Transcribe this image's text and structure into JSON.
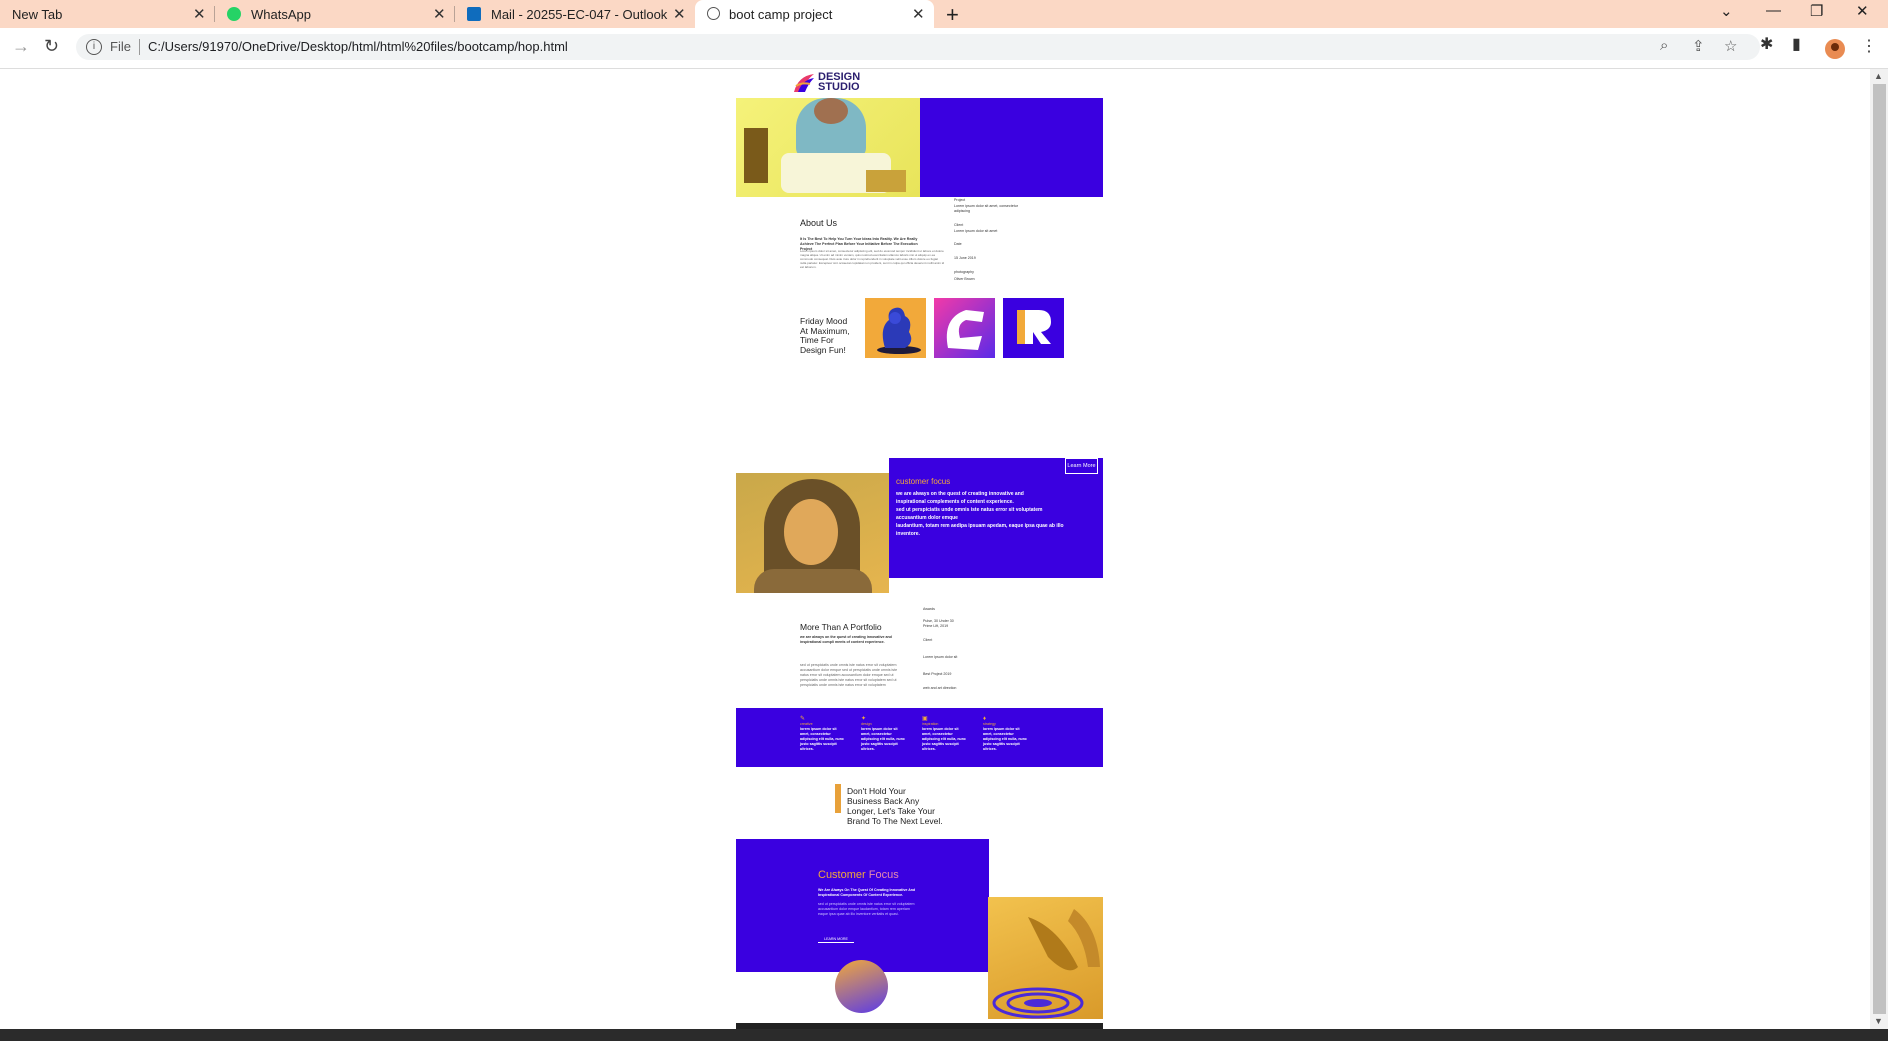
{
  "browser": {
    "tabs": [
      {
        "title": "New Tab",
        "active": false
      },
      {
        "title": "WhatsApp",
        "active": false
      },
      {
        "title": "Mail - 20255-EC-047 - Outlook",
        "active": false
      },
      {
        "title": "boot camp project",
        "active": true
      }
    ],
    "address": {
      "scheme_label": "File",
      "url": "C:/Users/91970/OneDrive/Desktop/html/html%20files/bootcamp/hop.html"
    },
    "colors": {
      "tabbar": "#fbd8c5",
      "omnibox": "#f1f3f4"
    }
  },
  "site": {
    "logo": {
      "line1": "DESIGN",
      "line2": "STUDIO"
    },
    "hero_meta": [
      {
        "label": "Project",
        "value": "Lorem ipsum dolor sit amet, consectetur adipiscing"
      },
      {
        "label": "Client",
        "value": "Lorem ipsum dolor sit amet"
      },
      {
        "label": "Date",
        "value": "15 June 2019"
      },
      {
        "label": "photography",
        "value": "Oliver Brown"
      }
    ],
    "about": {
      "title": "About Us",
      "lead": "It Is The Best To Help You Turn Your Ideas Into Reality. We Are Really Achieve The Perfect Plan Before Your Initiative Before The Execution Project",
      "body": "Lorem ipsum dolor sit amet, consectetur adipiscing elit, sed do eiusmod tempor incididunt ut labore et dolore magna aliqua. Ut enim ad minim veniam, quis nostrud exercitation ullamco laboris nisi ut aliquip ex ea commodo consequat. Duis aute irure dolor in reprehenderit in voluptate velit esse cillum dolore eu fugiat nulla pariatur. Excepteur sint occaecat cupidatat non proident, sunt in culpa qui officia deserunt mollit anim id est laborum."
    },
    "friday": {
      "lines": [
        "Friday Mood",
        "At Maximum,",
        "Time For",
        "Design Fun!"
      ]
    },
    "focus_card": {
      "button": "Learn More",
      "title": "customer focus",
      "lines": [
        "we are always on the quest of creating innovative and",
        "inspirational complements of content experience.",
        "sed ut perspiciatis unde omnis iste natus error sit voluptatem",
        "accusantium dolor emque",
        "laudantium, totam rem aedipa ipsuam apedam, eaque ipsa quae ab illo",
        "inventore."
      ]
    },
    "portfolio": {
      "title": "More Than A Portfolio",
      "lead": "we are always on the quest of creating innovative and inspirational compli ments of content experience.",
      "body": "sed ut perspiciatis unde omnis iste natus error sit voluptatem accusantium dolor emque sed ut perspiciatis unde omnis iste natus error sit voluptatem accusantium dolor emque sed ut perspiciatis unde omnis iste natus error sit voluptatem sed ut perspiciatis unde omnis iste natus error sit voluptatem",
      "meta": [
        {
          "label": "Awards",
          "value": "Pulse, 30 Under 30 Prime Lift, 2019"
        },
        {
          "label": "Client",
          "value": "Lorem ipsum dolor sit"
        },
        {
          "label": "",
          "value": "Best Project 2019"
        },
        {
          "label": "",
          "value": "web and art direction"
        }
      ]
    },
    "features": [
      {
        "icon": "✎",
        "title": "creative",
        "text": "lorem ipsum dolor sit amet, consectetur adipiscing elit nulla, nunc justo sagittis suscipit ultrices."
      },
      {
        "icon": "✦",
        "title": "design",
        "text": "lorem ipsum dolor sit amet, consectetur adipiscing elit nulla, nunc justo sagittis suscipit ultrices."
      },
      {
        "icon": "▣",
        "title": "inspiration",
        "text": "lorem ipsum dolor sit amet, consectetur adipiscing elit nulla, nunc justo sagittis suscipit ultrices."
      },
      {
        "icon": "♦",
        "title": "strategy",
        "text": "lorem ipsum dolor sit amet, consectetur adipiscing elit nulla, nunc justo sagittis suscipit ultrices."
      }
    ],
    "cta": {
      "lines": [
        "Don't Hold Your",
        "Business Back Any",
        "Longer, Let's Take Your",
        "Brand To The Next Level."
      ]
    },
    "focus2": {
      "title_a": "Customer",
      "title_b": "Focus",
      "lead": "We Are Always On The Quest Of Creating Innovative And Inspirational Components Of Content Experience.",
      "body": "sed ut perspiciatis unde omnis iste natus error sit voluptatem accusantium dolor emque laudantium, totam rem aperiam eaque ipsa quae ab illo inventore veritatis et quasi.",
      "button": "LEARN MORE"
    },
    "colors": {
      "brand_purple": "#3a00e0",
      "accent_orange": "#e8a13a",
      "hero_yellow": "#f2ee6a"
    }
  }
}
